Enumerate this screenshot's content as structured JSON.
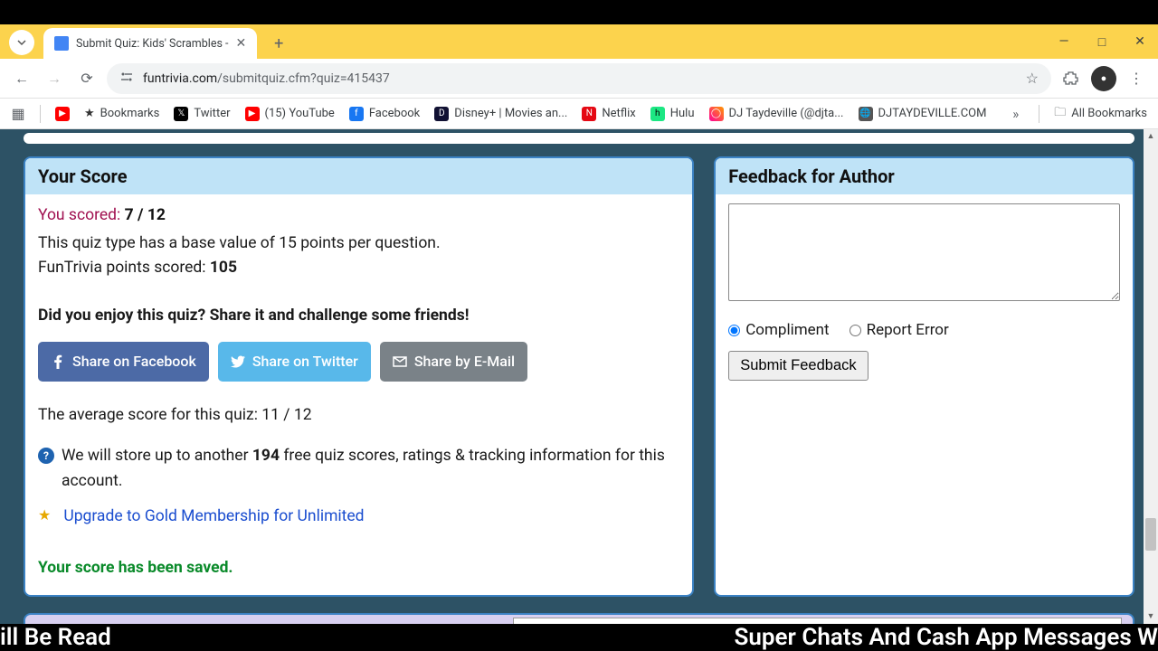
{
  "browser": {
    "tab_title": "Submit Quiz: Kids' Scrambles -",
    "url_host": "funtrivia.com",
    "url_path": "/submitquiz.cfm?quiz=415437",
    "bookmarks": [
      {
        "label": "",
        "icon_name": "apps-grid-icon"
      },
      {
        "label": "",
        "icon_name": "youtube-icon"
      },
      {
        "label": "Bookmarks",
        "icon_name": "star-icon"
      },
      {
        "label": "Twitter",
        "icon_name": "x-icon"
      },
      {
        "label": "(15) YouTube",
        "icon_name": "youtube-icon"
      },
      {
        "label": "Facebook",
        "icon_name": "facebook-icon"
      },
      {
        "label": "Disney+ | Movies an...",
        "icon_name": "disney-icon"
      },
      {
        "label": "Netflix",
        "icon_name": "netflix-icon"
      },
      {
        "label": "Hulu",
        "icon_name": "hulu-icon"
      },
      {
        "label": "DJ Taydeville (@djta...",
        "icon_name": "instagram-icon"
      },
      {
        "label": "DJTAYDEVILLE.COM",
        "icon_name": "globe-icon"
      }
    ],
    "all_bookmarks_label": "All Bookmarks"
  },
  "score_card": {
    "header": "Your Score",
    "scored_prefix": "You scored:",
    "scored_value": "7 / 12",
    "base_value_text": "This quiz type has a base value of 15 points per question.",
    "points_prefix": "FunTrivia points scored: ",
    "points_value": "105",
    "enjoy_text": "Did you enjoy this quiz? Share it and challenge some friends!",
    "share_fb": "Share on Facebook",
    "share_tw": "Share on Twitter",
    "share_em": "Share by E-Mail",
    "avg_text": "The average score for this quiz: 11 / 12",
    "info_prefix": "We will store up to another ",
    "info_number": "194",
    "info_suffix": " free quiz scores, ratings & tracking information for this account.",
    "upgrade_text": "Upgrade to Gold Membership for Unlimited",
    "saved_text": "Your score has been saved."
  },
  "feedback_card": {
    "header": "Feedback for Author",
    "radio_compliment": "Compliment",
    "radio_report": "Report Error",
    "submit_label": "Submit Feedback"
  },
  "ticker": {
    "left": "ill Be Read",
    "right": "Super Chats And Cash App Messages W"
  }
}
